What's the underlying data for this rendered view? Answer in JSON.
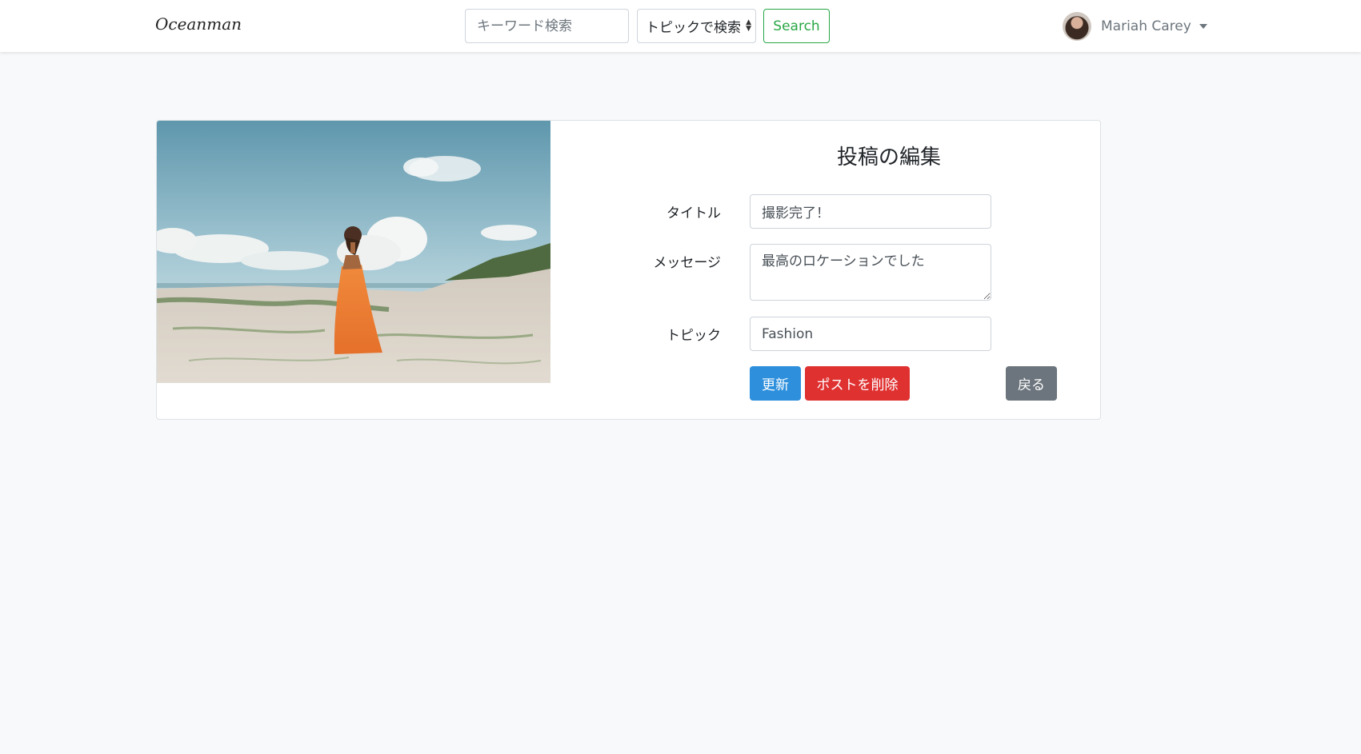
{
  "navbar": {
    "brand": "Oceanman",
    "keyword_placeholder": "キーワード検索",
    "topic_select": "トピックで検索",
    "search_label": "Search",
    "user_name": "Mariah Carey"
  },
  "form": {
    "heading": "投稿の編集",
    "title_label": "タイトル",
    "title_value": "撮影完了！",
    "message_label": "メッセージ",
    "message_value": "最高のロケーションでした",
    "topic_label": "トピック",
    "topic_value": "Fashion",
    "update_label": "更新",
    "delete_label": "ポストを削除",
    "back_label": "戻る"
  },
  "colors": {
    "search_green": "#28a745",
    "update_blue": "#2e8fdd",
    "delete_red": "#e03131",
    "back_gray": "#6c757d"
  }
}
